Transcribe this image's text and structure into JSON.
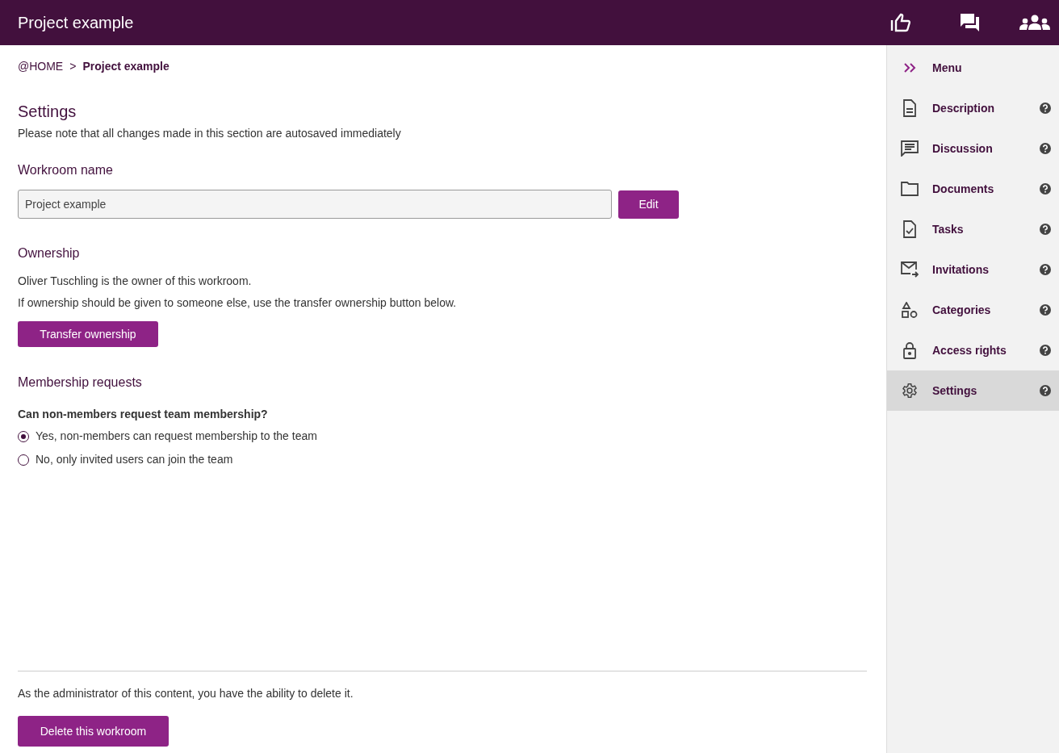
{
  "header": {
    "title": "Project example"
  },
  "breadcrumb": [
    {
      "label": "@HOME",
      "current": false
    },
    {
      "label": "Project example",
      "current": true
    }
  ],
  "breadcrumb_separator": ">",
  "settings": {
    "title": "Settings",
    "note": "Please note that all changes made in this section are autosaved immediately"
  },
  "workroom_name": {
    "heading": "Workroom name",
    "value": "Project example",
    "button": "Edit"
  },
  "ownership": {
    "heading": "Ownership",
    "lines": [
      "Oliver Tuschling is the owner of this workroom.",
      "If ownership should be given to someone else, use the transfer ownership button below."
    ],
    "button": "Transfer ownership"
  },
  "membership": {
    "heading": "Membership requests",
    "question": "Can non-members request team membership?",
    "options": [
      {
        "label": "Yes, non-members can request membership to the team",
        "selected": true
      },
      {
        "label": "No, only invited users can join the team",
        "selected": false
      }
    ]
  },
  "admin": {
    "note": "As the administrator of this content, you have the ability to delete it.",
    "button": "Delete this workroom"
  },
  "sidebar": {
    "items": [
      {
        "kind": "menu",
        "label": "Menu",
        "help": false,
        "selected": false
      },
      {
        "kind": "description",
        "label": "Description",
        "help": true,
        "selected": false
      },
      {
        "kind": "discussion",
        "label": "Discussion",
        "help": true,
        "selected": false
      },
      {
        "kind": "documents",
        "label": "Documents",
        "help": true,
        "selected": false
      },
      {
        "kind": "tasks",
        "label": "Tasks",
        "help": true,
        "selected": false
      },
      {
        "kind": "invitations",
        "label": "Invitations",
        "help": true,
        "selected": false
      },
      {
        "kind": "categories",
        "label": "Categories",
        "help": true,
        "selected": false
      },
      {
        "kind": "access",
        "label": "Access rights",
        "help": true,
        "selected": false
      },
      {
        "kind": "settings",
        "label": "Settings",
        "help": true,
        "selected": true
      }
    ]
  }
}
